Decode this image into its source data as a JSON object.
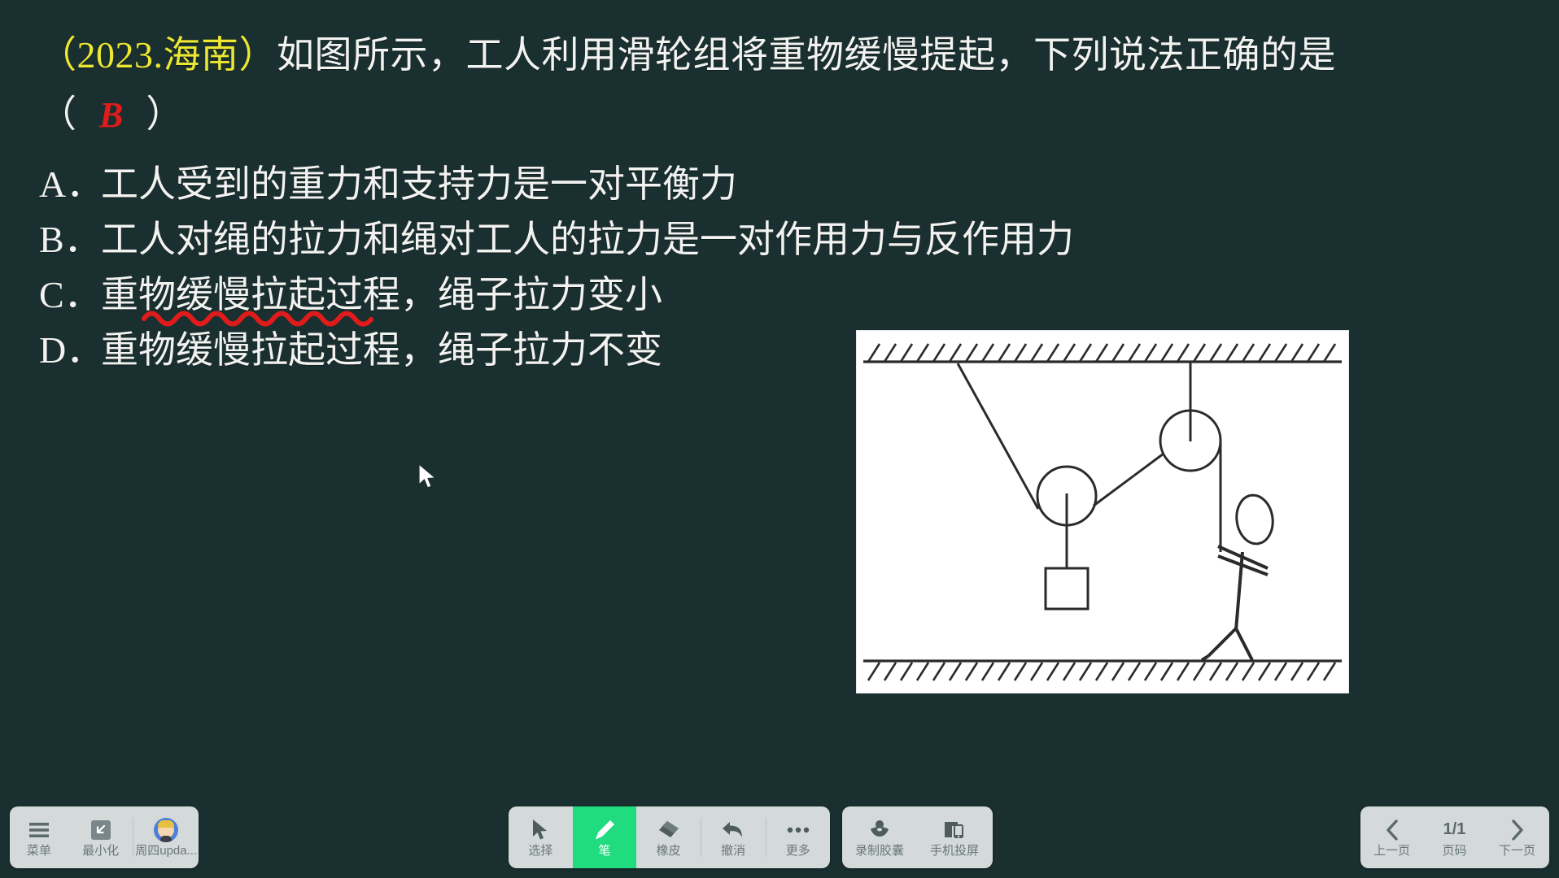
{
  "slide": {
    "source_tag": "（2023.海南）",
    "question_text": "如图所示，工人利用滑轮组将重物缓慢提起，下列说法正确的是",
    "answer_open_paren": "（",
    "answer_letter": "B",
    "answer_close_paren": "）",
    "options": [
      {
        "label": "A．",
        "text": "工人受到的重力和支持力是一对平衡力",
        "underlined": false
      },
      {
        "label": "B．",
        "text": "工人对绳的拉力和绳对工人的拉力是一对作用力与反作用力",
        "underlined": false
      },
      {
        "label": "C．",
        "text": "重物缓慢拉起过程，绳子拉力变小",
        "underlined": true
      },
      {
        "label": "D．",
        "text": "重物缓慢拉起过程，绳子拉力不变",
        "underlined": false
      }
    ],
    "diagram_alt": "滑轮组示意图：定滑轮与动滑轮，重物悬挂于动滑轮，工人在地面拉绳",
    "colors": {
      "background": "#1a2f2f",
      "text": "#f2f2f0",
      "source_tag": "#ece732",
      "answer": "#e01b1b",
      "annotation": "#e01b1b"
    }
  },
  "toolbar": {
    "left": [
      {
        "name": "menu",
        "label": "菜单",
        "icon": "hamburger-icon"
      },
      {
        "name": "minimize",
        "label": "最小化",
        "icon": "minimize-icon"
      },
      {
        "name": "account",
        "label": "周四upda...",
        "icon": "avatar-icon"
      }
    ],
    "tools": [
      {
        "name": "select",
        "label": "选择",
        "icon": "cursor-icon",
        "active": false
      },
      {
        "name": "pen",
        "label": "笔",
        "icon": "pen-icon",
        "active": true
      },
      {
        "name": "eraser",
        "label": "橡皮",
        "icon": "eraser-icon",
        "active": false
      },
      {
        "name": "undo",
        "label": "撤消",
        "icon": "undo-arrow-icon",
        "active": false
      },
      {
        "name": "more",
        "label": "更多",
        "icon": "ellipsis-icon",
        "active": false
      }
    ],
    "media": [
      {
        "name": "record-capsule",
        "label": "录制胶囊",
        "icon": "record-icon"
      },
      {
        "name": "phone-cast",
        "label": "手机投屏",
        "icon": "cast-icon"
      }
    ],
    "pagination": {
      "prev_label": "上一页",
      "page_value": "1/1",
      "page_label": "页码",
      "next_label": "下一页"
    },
    "colors": {
      "panel": "#d4d9d9",
      "active": "#21dc7e",
      "icon": "#5c6a6a",
      "label": "#6a7878"
    }
  }
}
